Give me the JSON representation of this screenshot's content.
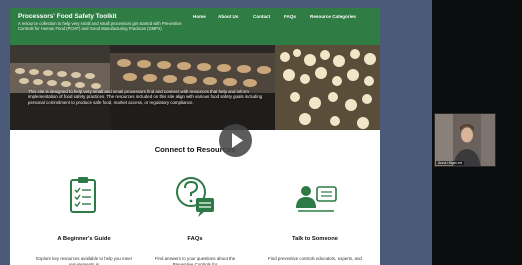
{
  "site": {
    "title": "Processors' Food Safety Toolkit",
    "subtitle": "A resource collection to help very small and small processors get started with Preventive Controls for Human Food (PCHF) and Good Manufacturing Practices (GMPs)",
    "nav": [
      "Home",
      "About Us",
      "Contact",
      "FAQs",
      "Resource Categories"
    ],
    "hero_text": "This site is designed to help very small and small processors find and connect with resources that help and inform implementation of food safety practices. The resources included on this site align with various food safety goals including personal commitment to produce safe food, market access, or regulatory compliance.",
    "section_title": "Connect to Resources",
    "cards": [
      {
        "icon": "clipboard-checklist-icon",
        "title": "A Beginner's Guide",
        "desc": "Explore key resources available to help you meet requirements in"
      },
      {
        "icon": "question-chat-icon",
        "title": "FAQs",
        "desc": "Find answers to your questions about the Preventive Controls for"
      },
      {
        "icon": "person-card-icon",
        "title": "Talk to Someone",
        "desc": "Find preventive controls educators, experts, and"
      }
    ]
  },
  "colors": {
    "header_green": "#2f7d45",
    "icon_green": "#2c7a45",
    "screen_slate": "#4a5a78"
  },
  "video": {
    "play_icon": "play-icon"
  },
  "webcam": {
    "participant_name": "Anna Hilger-ert"
  }
}
